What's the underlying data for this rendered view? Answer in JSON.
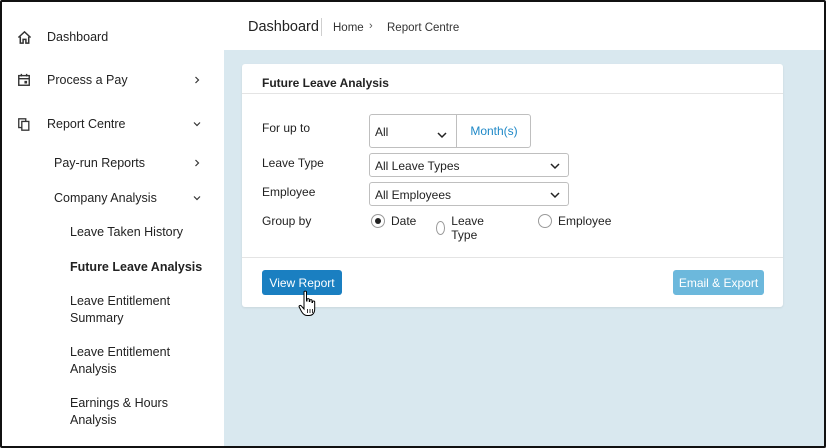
{
  "header": {
    "title": "Dashboard",
    "breadcrumb": [
      "Home",
      "Report Centre"
    ]
  },
  "sidebar": {
    "items": [
      {
        "label": "Dashboard",
        "icon": "home-icon"
      },
      {
        "label": "Process a Pay",
        "icon": "calendar-icon"
      },
      {
        "label": "Report Centre",
        "icon": "documents-icon"
      }
    ],
    "sub_items": [
      {
        "label": "Pay-run Reports"
      },
      {
        "label": "Company Analysis"
      }
    ],
    "leaf_items": [
      {
        "label": "Leave Taken History"
      },
      {
        "label": "Future Leave Analysis",
        "active": true
      },
      {
        "label": "Leave Entitlement Summary"
      },
      {
        "label": "Leave Entitlement Analysis"
      },
      {
        "label": "Earnings & Hours Analysis"
      }
    ]
  },
  "report": {
    "title": "Future Leave Analysis",
    "for_up_to": {
      "label": "For up to",
      "value": "All",
      "unit_button": "Month(s)"
    },
    "leave_type": {
      "label": "Leave Type",
      "value": "All Leave Types"
    },
    "employee": {
      "label": "Employee",
      "value": "All Employees"
    },
    "group_by": {
      "label": "Group by",
      "options": [
        "Date",
        "Leave Type",
        "Employee"
      ],
      "selected": "Date"
    },
    "view_button": "View Report",
    "export_button": "Email & Export"
  },
  "colors": {
    "primary": "#1a7fc1",
    "secondary": "#6cb8dc",
    "content_bg": "#d9e8ef",
    "link": "#1e88c7"
  }
}
